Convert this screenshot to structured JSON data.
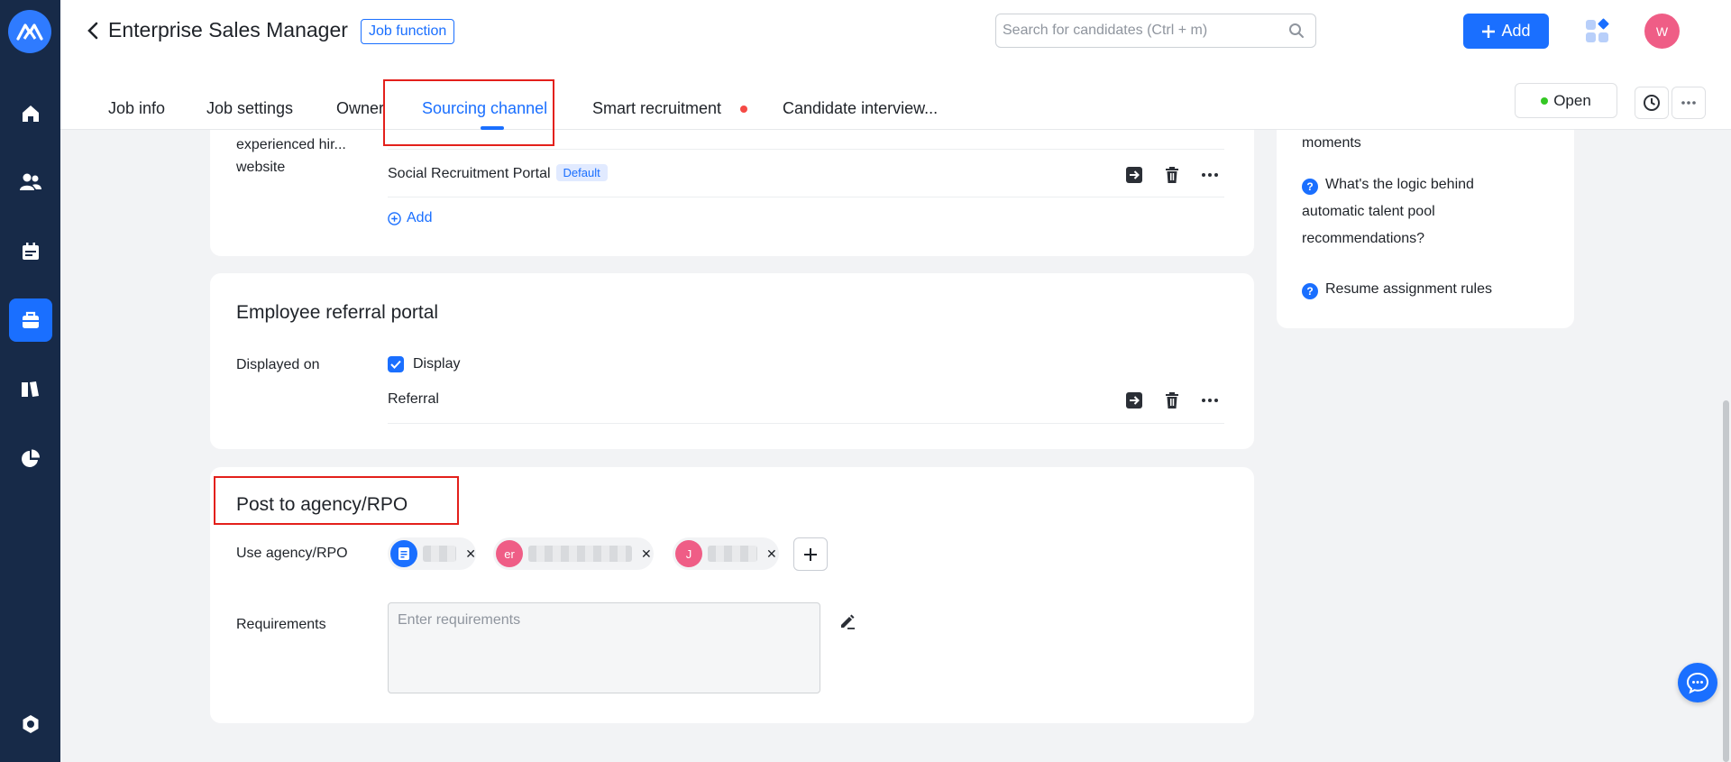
{
  "header": {
    "job_title": "Enterprise Sales Manager",
    "job_function_tag": "Job function",
    "search_placeholder": "Search for candidates (Ctrl + m)",
    "add_label": "Add",
    "avatar_initial": "W",
    "status_label": "Open"
  },
  "tabs": [
    {
      "label": "Job info"
    },
    {
      "label": "Job settings"
    },
    {
      "label": "Owner"
    },
    {
      "label": "Sourcing channel",
      "active": true
    },
    {
      "label": "Smart recruitment",
      "has_dot": true
    },
    {
      "label": "Candidate interview..."
    }
  ],
  "website_section": {
    "label_lines": [
      "experienced hir...",
      "website"
    ],
    "rows": [
      {
        "name": "Social Recruitment Portal",
        "badge": "Default"
      }
    ],
    "add_label": "Add"
  },
  "referral_section": {
    "title": "Employee referral portal",
    "displayed_on_label": "Displayed on",
    "display_checkbox_label": "Display",
    "display_checked": true,
    "rows": [
      {
        "name": "Referral"
      }
    ]
  },
  "agency_section": {
    "title": "Post to agency/RPO",
    "use_agency_label": "Use agency/RPO",
    "agencies": [
      {
        "avatar_text": "",
        "avatar_color": "#1a6fff"
      },
      {
        "avatar_text": "er",
        "avatar_color": "#ef5d86"
      },
      {
        "avatar_text": "J",
        "avatar_color": "#ef5d86"
      }
    ],
    "requirements_label": "Requirements",
    "requirements_placeholder": "Enter requirements"
  },
  "help_panel": {
    "items": [
      {
        "text": "moments"
      },
      {
        "text_lines": [
          "What's the logic behind",
          "automatic talent pool",
          "recommendations?"
        ]
      },
      {
        "text": "Resume assignment rules"
      }
    ]
  },
  "colors": {
    "primary": "#1a6fff",
    "sidebar": "#172a48",
    "highlight": "#e3201b",
    "avatar_pink": "#ef5d86",
    "status_green": "#34c724"
  }
}
